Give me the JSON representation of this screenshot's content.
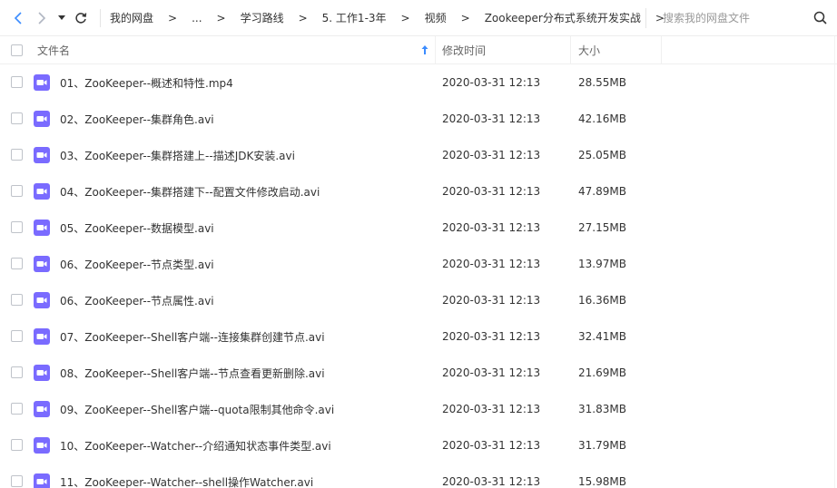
{
  "toolbar": {
    "breadcrumbs": [
      "我的网盘",
      "...",
      "学习路线",
      "5. 工作1-3年",
      "视频",
      "Zookeeper分布式系统开发实战"
    ],
    "separator": ">",
    "search_placeholder": "搜索我的网盘文件"
  },
  "header": {
    "name": "文件名",
    "time": "修改时间",
    "size": "大小"
  },
  "colors": {
    "accent": "#3b8cff",
    "video_icon": "#7a6bff",
    "nav_active": "#3b8cff",
    "nav_inactive": "#b0b6c2"
  },
  "files": [
    {
      "name": "01、ZooKeeper--概述和特性.mp4",
      "time": "2020-03-31 12:13",
      "size": "28.55MB"
    },
    {
      "name": "02、ZooKeeper--集群角色.avi",
      "time": "2020-03-31 12:13",
      "size": "42.16MB"
    },
    {
      "name": "03、ZooKeeper--集群搭建上--描述JDK安装.avi",
      "time": "2020-03-31 12:13",
      "size": "25.05MB"
    },
    {
      "name": "04、ZooKeeper--集群搭建下--配置文件修改启动.avi",
      "time": "2020-03-31 12:13",
      "size": "47.89MB"
    },
    {
      "name": "05、ZooKeeper--数据模型.avi",
      "time": "2020-03-31 12:13",
      "size": "27.15MB"
    },
    {
      "name": "06、ZooKeeper--节点类型.avi",
      "time": "2020-03-31 12:13",
      "size": "13.97MB"
    },
    {
      "name": "06、ZooKeeper--节点属性.avi",
      "time": "2020-03-31 12:13",
      "size": "16.36MB"
    },
    {
      "name": "07、ZooKeeper--Shell客户端--连接集群创建节点.avi",
      "time": "2020-03-31 12:13",
      "size": "32.41MB"
    },
    {
      "name": "08、ZooKeeper--Shell客户端--节点查看更新删除.avi",
      "time": "2020-03-31 12:13",
      "size": "21.69MB"
    },
    {
      "name": "09、ZooKeeper--Shell客户端--quota限制其他命令.avi",
      "time": "2020-03-31 12:13",
      "size": "31.83MB"
    },
    {
      "name": "10、ZooKeeper--Watcher--介绍通知状态事件类型.avi",
      "time": "2020-03-31 12:13",
      "size": "31.79MB"
    },
    {
      "name": "11、ZooKeeper--Watcher--shell操作Watcher.avi",
      "time": "2020-03-31 12:13",
      "size": "15.98MB"
    }
  ]
}
